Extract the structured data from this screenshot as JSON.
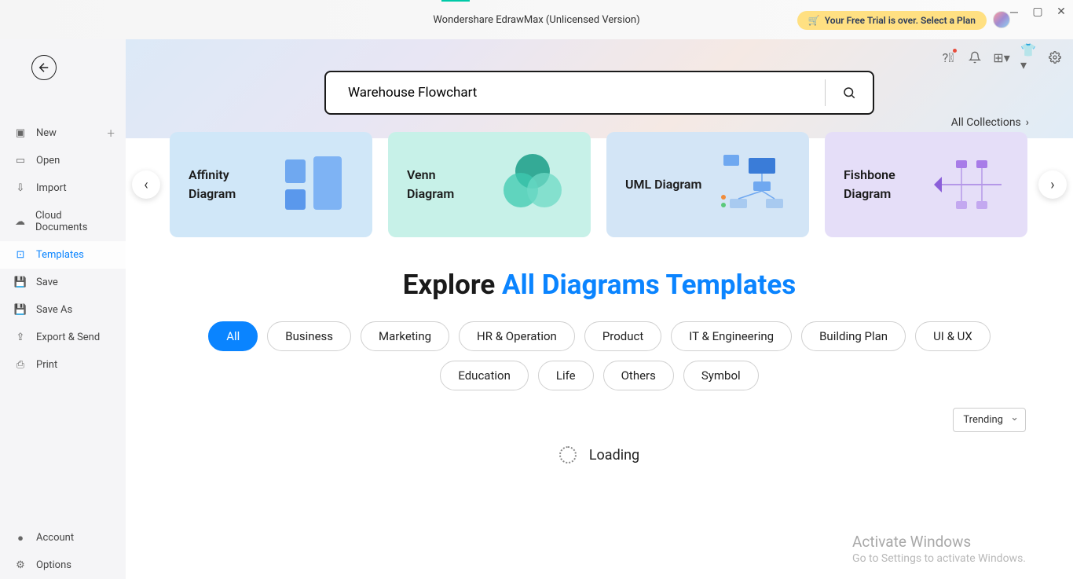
{
  "app": {
    "title": "Wondershare EdrawMax (Unlicensed Version)"
  },
  "trial": {
    "icon": "cart-icon",
    "text": "Your Free Trial is over. Select a Plan"
  },
  "sidebar": {
    "items": [
      {
        "label": "New",
        "icon": "plus-square-icon",
        "showPlus": true
      },
      {
        "label": "Open",
        "icon": "folder-icon"
      },
      {
        "label": "Import",
        "icon": "import-icon"
      },
      {
        "label": "Cloud Documents",
        "icon": "cloud-icon"
      },
      {
        "label": "Templates",
        "icon": "template-icon",
        "active": true
      },
      {
        "label": "Save",
        "icon": "save-icon"
      },
      {
        "label": "Save As",
        "icon": "save-as-icon"
      },
      {
        "label": "Export & Send",
        "icon": "export-icon"
      },
      {
        "label": "Print",
        "icon": "print-icon"
      }
    ],
    "footer": [
      {
        "label": "Account",
        "icon": "account-icon"
      },
      {
        "label": "Options",
        "icon": "gear-icon"
      }
    ]
  },
  "search": {
    "value": "Warehouse Flowchart"
  },
  "all_collections": "All Collections",
  "cards": [
    {
      "label": "Affinity Diagram"
    },
    {
      "label": "Venn Diagram"
    },
    {
      "label": "UML Diagram"
    },
    {
      "label": "Fishbone Diagram"
    }
  ],
  "explore": {
    "prefix": "Explore ",
    "highlight": "All Diagrams Templates"
  },
  "chips": [
    "All",
    "Business",
    "Marketing",
    "HR & Operation",
    "Product",
    "IT & Engineering",
    "Building Plan",
    "UI & UX",
    "Education",
    "Life",
    "Others",
    "Symbol"
  ],
  "active_chip": "All",
  "sort": {
    "selected": "Trending"
  },
  "loading": "Loading",
  "watermark": {
    "title": "Activate Windows",
    "sub": "Go to Settings to activate Windows."
  }
}
